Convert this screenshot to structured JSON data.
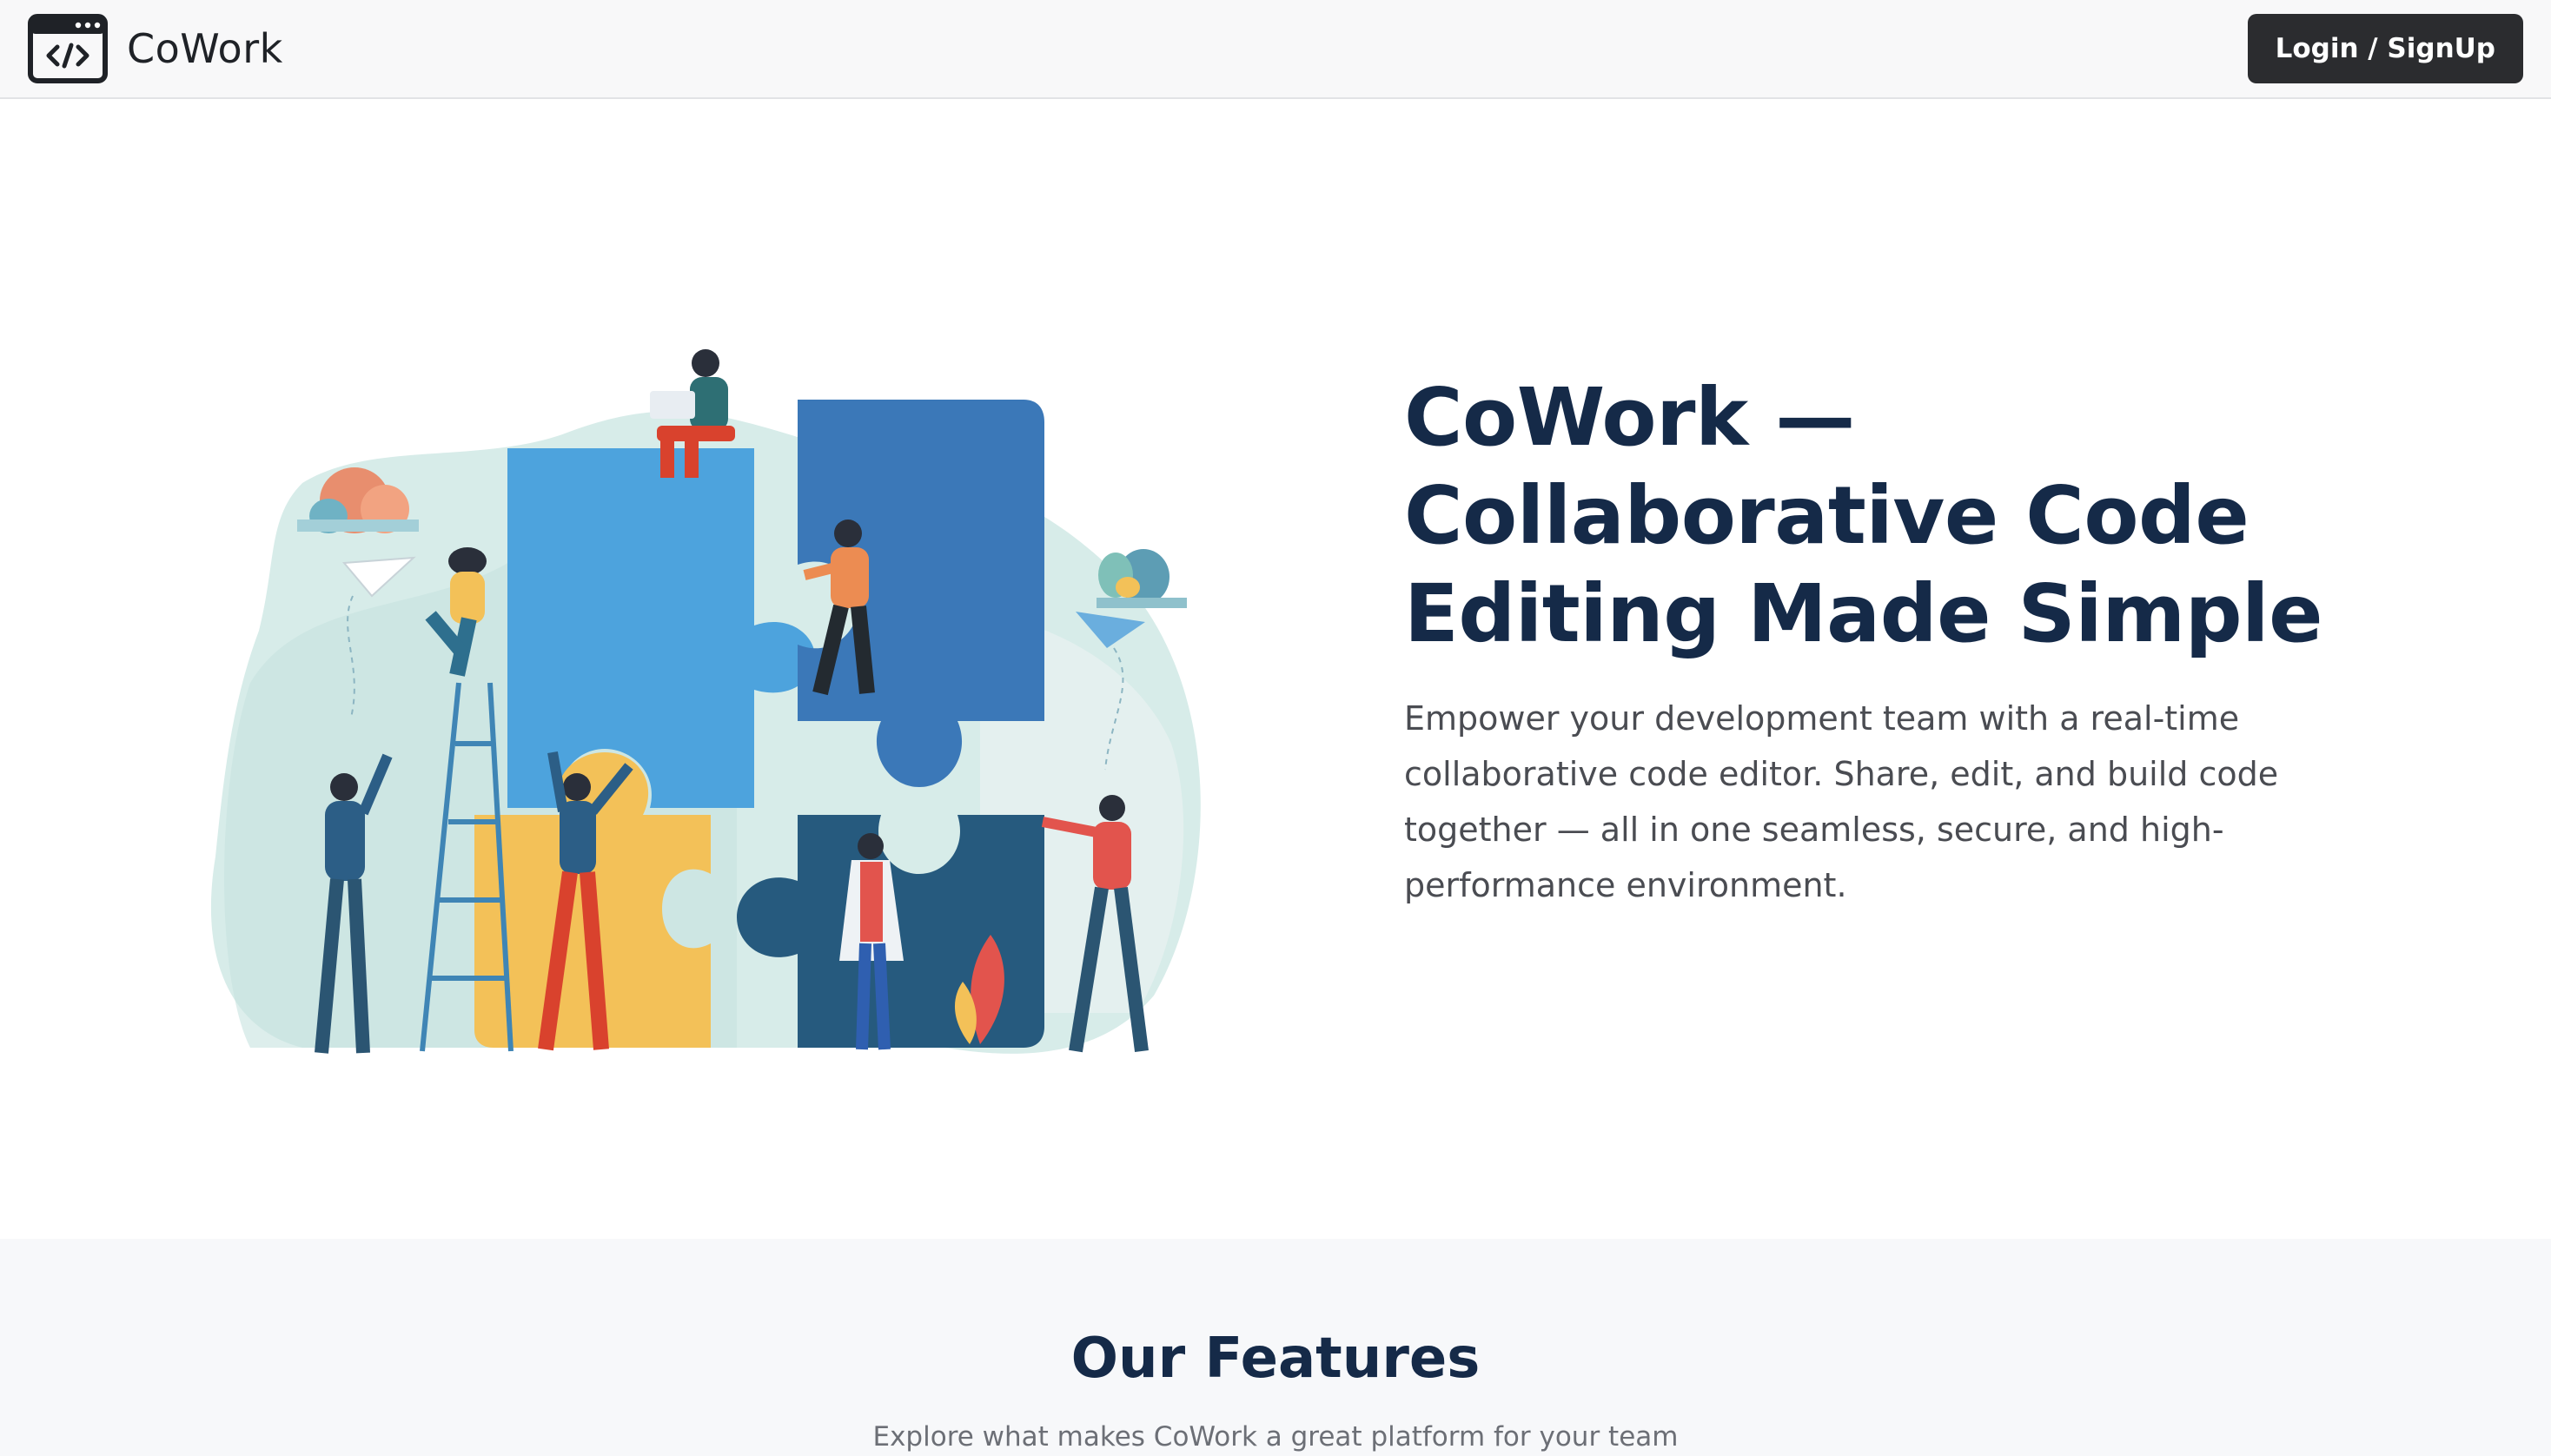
{
  "navbar": {
    "brand_icon": "code-window-icon",
    "brand_name": "CoWork",
    "login_label": "Login / SignUp"
  },
  "hero": {
    "illustration": "team-puzzle-illustration",
    "title": "CoWork — Collaborative Code Editing Made Simple",
    "description": "Empower your development team with a real-time collaborative code editor. Share, edit, and build code together — all in one seamless, secure, and high-performance environment."
  },
  "features": {
    "title": "Our Features",
    "subtitle": "Explore what makes CoWork a great platform for your team"
  },
  "colors": {
    "nav_bg": "#f8f8f9",
    "button_bg": "#2b2c2f",
    "heading": "#152a48",
    "body_text": "#4a4c52",
    "features_bg": "#f7f8fa",
    "puzzle_light_blue": "#4da3dd",
    "puzzle_blue": "#3b78b8",
    "puzzle_yellow": "#f3c158",
    "puzzle_navy": "#265a7e"
  }
}
